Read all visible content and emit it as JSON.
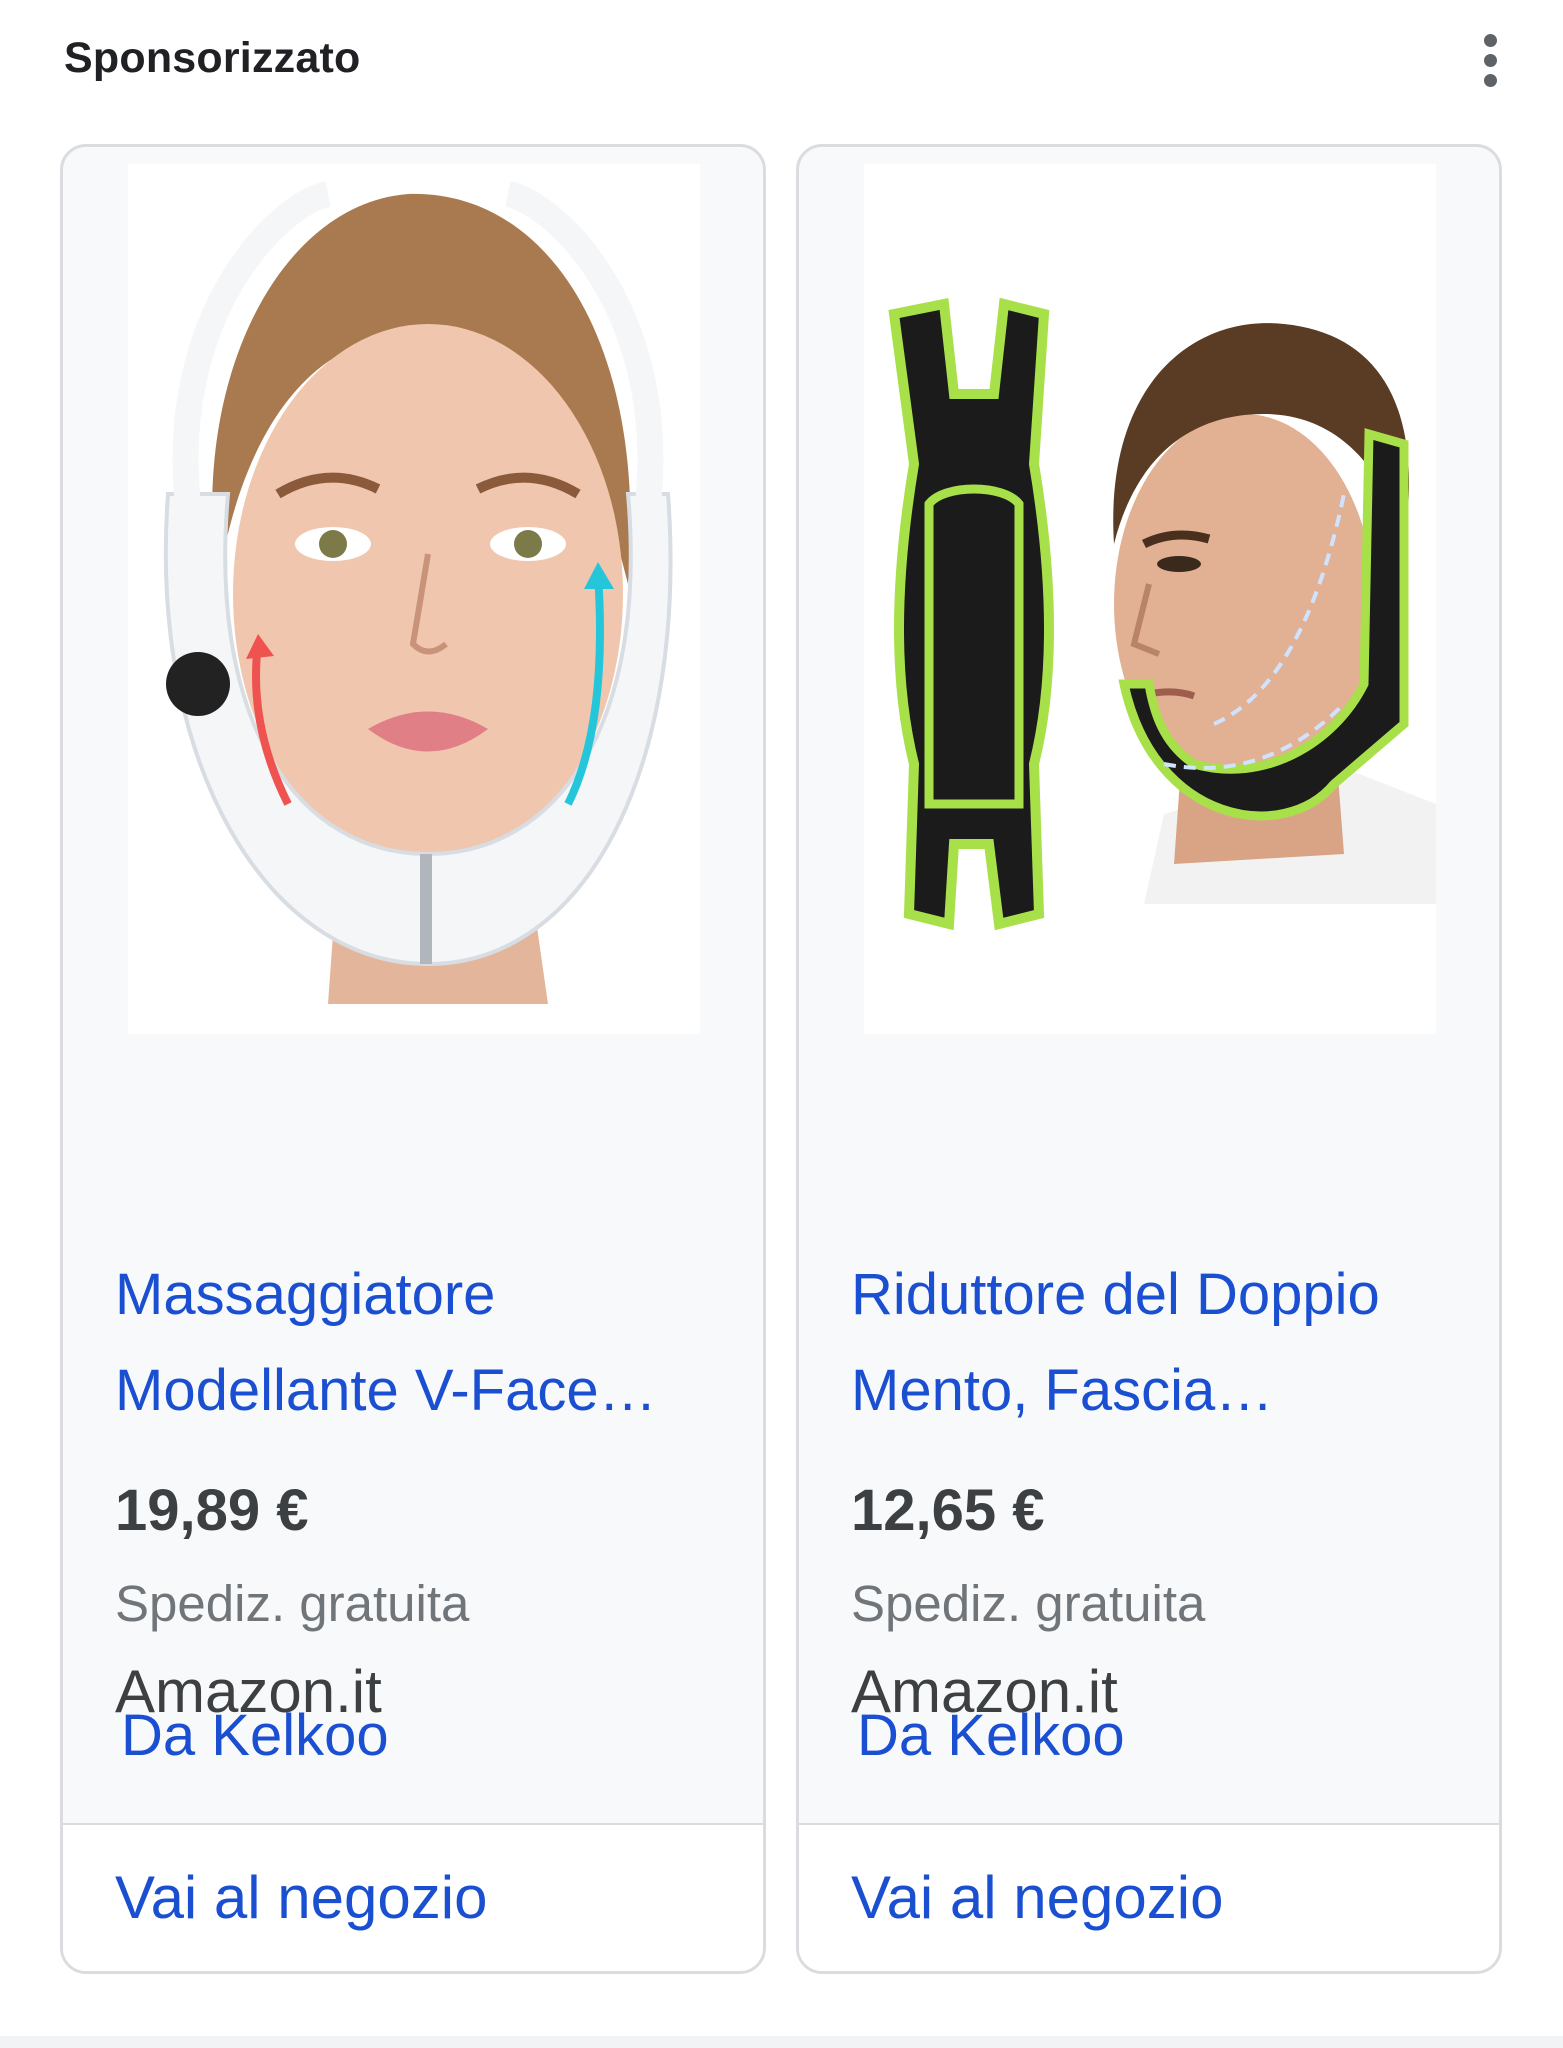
{
  "header": {
    "title": "Sponsorizzato",
    "menu_icon": "more-vert-icon"
  },
  "colors": {
    "link": "#1a4fd1",
    "text": "#3c4043",
    "muted": "#70757a",
    "border": "#dadce0"
  },
  "products": [
    {
      "title_line1": "Massaggiatore",
      "title_line2": "Modellante V-Face…",
      "price": "19,89 €",
      "shipping": "Spediz. gratuita",
      "merchant": "Amazon.it",
      "by": "Da Kelkoo",
      "cta": "Vai al negozio"
    },
    {
      "title_line1": "Riduttore del Doppio",
      "title_line2": "Mento, Fascia…",
      "price": "12,65 €",
      "shipping": "Spediz. gratuita",
      "merchant": "Amazon.it",
      "by": "Da Kelkoo",
      "cta": "Vai al negozio"
    }
  ]
}
